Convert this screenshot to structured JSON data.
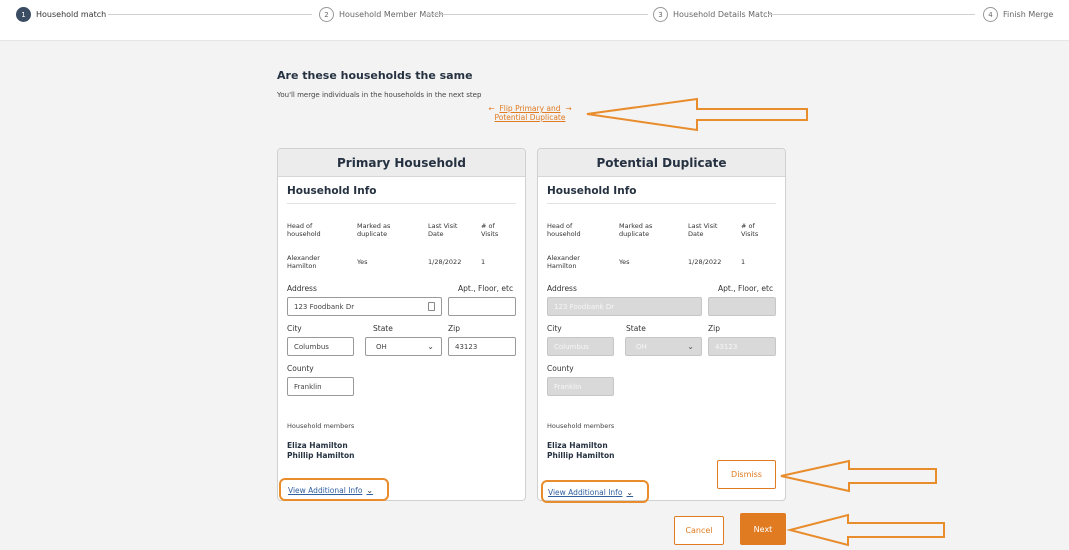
{
  "steps": [
    {
      "num": "1",
      "label": "Household match"
    },
    {
      "num": "2",
      "label": "Household Member Match"
    },
    {
      "num": "3",
      "label": "Household Details Match"
    },
    {
      "num": "4",
      "label": "Finish Merge"
    }
  ],
  "page": {
    "heading": "Are these households the same",
    "subtext": "You'll merge individuals in the households in the next step",
    "flip_arrows": {
      "left": "←",
      "right": "→"
    },
    "flip_line1": "Flip Primary and",
    "flip_line2": "Potential Duplicate"
  },
  "table_headers": {
    "head": [
      "Head of",
      "household"
    ],
    "marked": [
      "Marked as",
      "duplicate"
    ],
    "last_visit": [
      "Last Visit",
      "Date"
    ],
    "visits": [
      "# of",
      "Visits"
    ]
  },
  "field_labels": {
    "address": "Address",
    "apt": "Apt., Floor, etc",
    "city": "City",
    "state": "State",
    "zip": "Zip",
    "county": "County"
  },
  "section_title": "Household Info",
  "members_label": "Household members",
  "view_more": "View Additional Info",
  "primary": {
    "title": "Primary Household",
    "head_first": "Alexander",
    "head_last": "Hamilton",
    "marked": "Yes",
    "last_visit": "1/28/2022",
    "visits": "1",
    "address": "123 Foodbank Dr",
    "apt": "",
    "city": "Columbus",
    "state": "OH",
    "zip": "43123",
    "county": "Franklin",
    "members": [
      "Eliza Hamilton",
      "Phillip Hamilton"
    ]
  },
  "duplicate": {
    "title": "Potential Duplicate",
    "head_first": "Alexander",
    "head_last": "Hamilton",
    "marked": "Yes",
    "last_visit": "1/28/2022",
    "visits": "1",
    "address": "123 Foodbank Dr",
    "apt": "",
    "city": "Columbus",
    "state": "OH",
    "zip": "43123",
    "county": "Franklin",
    "members": [
      "Eliza Hamilton",
      "Phillip Hamilton"
    ]
  },
  "buttons": {
    "dismiss": "Dismiss",
    "cancel": "Cancel",
    "next": "Next"
  },
  "icons": {
    "chevron": "⌄",
    "chevron_down": "⌄"
  },
  "colors": {
    "accent": "#e07b22",
    "annotation": "#e88c2c",
    "heading": "#263241",
    "link": "#2f5f9e"
  }
}
